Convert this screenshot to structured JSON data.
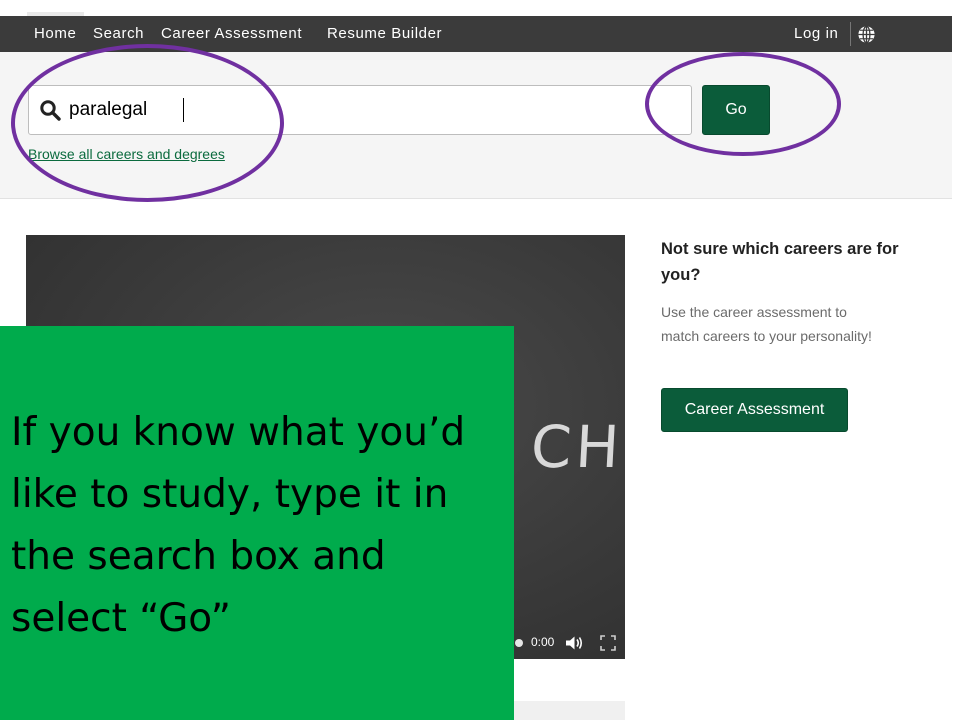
{
  "nav": {
    "items": [
      {
        "label": "Home"
      },
      {
        "label": "Search"
      },
      {
        "label": "Career Assessment"
      },
      {
        "label": "Resume Builder"
      }
    ],
    "login_label": "Log in",
    "globe_icon": "globe-icon"
  },
  "search": {
    "value": "paralegal",
    "go_label": "Go",
    "browse_link": "Browse all careers and degrees",
    "icon": "search-icon"
  },
  "video": {
    "chalk_text": "CH",
    "time": "0:00",
    "icons": [
      "volume-icon",
      "fullscreen-icon"
    ]
  },
  "sidebar": {
    "title": "Not sure which careers are for you?",
    "description": "Use the career assessment to match careers to your personality!",
    "button_label": "Career Assessment"
  },
  "callout": {
    "text": "If you know what you’d like to study, type it in the search box and select “Go”"
  },
  "colors": {
    "nav_bg": "#3b3b3b",
    "brand_green": "#0b5c3a",
    "callout_green": "#00ab4c",
    "annotation_purple": "#7030a0"
  }
}
